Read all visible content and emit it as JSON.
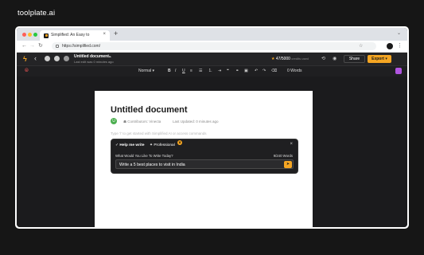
{
  "brand": "toolplate.ai",
  "browser": {
    "tab_title": "Simplified: An Easy to",
    "tab_close": "×",
    "new_tab": "+",
    "url": "https://simplified.com/"
  },
  "app": {
    "doc_title": "Untitled document",
    "doc_subtitle": "Last edit was 0 minutes ago",
    "credits_value": "47/5000",
    "credits_label": "credits used",
    "share_label": "Share",
    "export_label": "Export"
  },
  "toolbar": {
    "style_select": "Normal",
    "bold": "B",
    "italic": "I",
    "underline": "U",
    "word_count": "0 Words"
  },
  "document": {
    "heading": "Untitled document",
    "author_initial": "U",
    "contributors": "Contributors: Vinecta",
    "last_updated": "Last Updated: 0 minutes ago",
    "placeholder": "Type '/' to get started with Simplified AI or access commands"
  },
  "ai_popup": {
    "tab_help": "Help me write",
    "tab_professional": "Professional",
    "question": "What Would You Like To Write Today?",
    "word_counter": "9/240 Words",
    "input_value": "Write a 5 best places to visit in India"
  },
  "colors": {
    "accent": "#f5a623",
    "background": "#161616",
    "editor_bg": "#1b1b1d"
  }
}
